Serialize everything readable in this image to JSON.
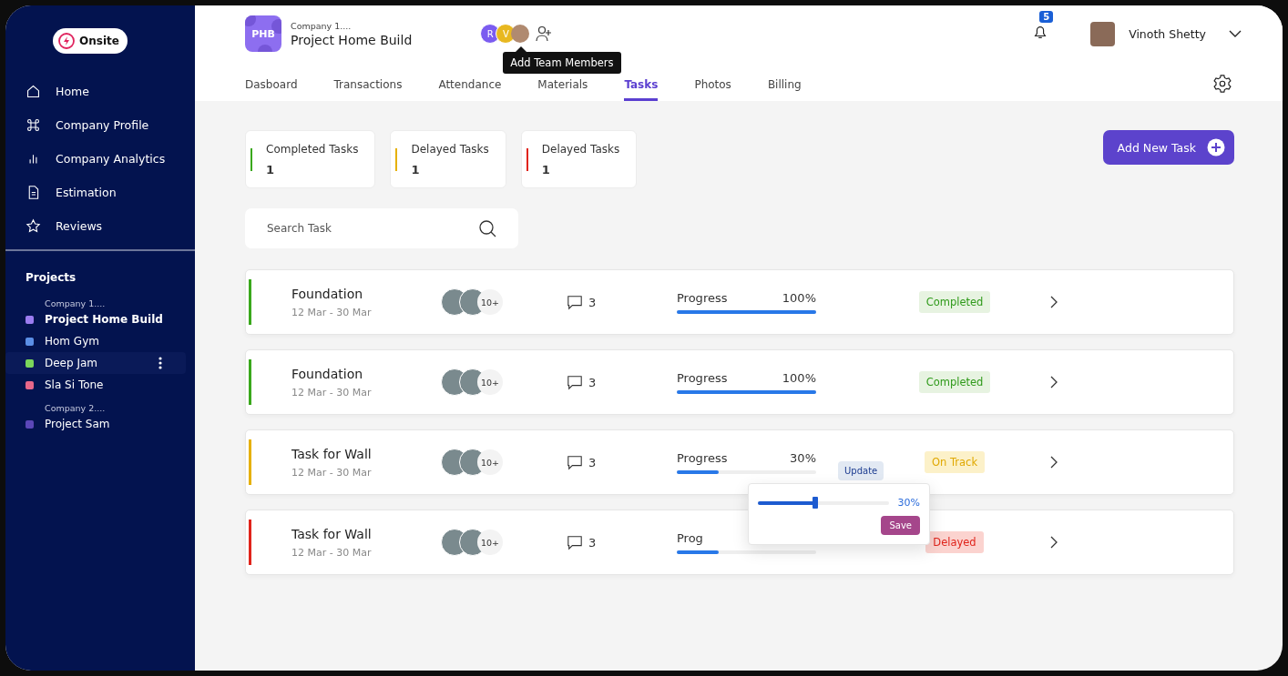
{
  "sidebar": {
    "logo": "Onsite",
    "nav": [
      {
        "label": "Home",
        "kind": "home"
      },
      {
        "label": "Company Profile",
        "kind": "command"
      },
      {
        "label": "Company Analytics",
        "kind": "chart"
      },
      {
        "label": "Estimation",
        "kind": "doc"
      },
      {
        "label": "Reviews",
        "kind": "star"
      }
    ],
    "projects_title": "Projects",
    "groups": [
      {
        "company": "Company 1....",
        "projects": [
          {
            "name": "Project Home Build",
            "color": "#9b7cf0",
            "selected": true,
            "highlighted": false
          },
          {
            "name": "Hom Gym",
            "color": "#5b8fe6",
            "selected": false,
            "highlighted": false
          },
          {
            "name": "Deep Jam",
            "color": "#7bd65b",
            "selected": false,
            "highlighted": true
          },
          {
            "name": "Sla Si Tone",
            "color": "#e8678a",
            "selected": false,
            "highlighted": false
          }
        ]
      },
      {
        "company": "Company 2....",
        "projects": [
          {
            "name": "Project Sam",
            "color": "#5b47b8",
            "selected": false,
            "highlighted": false
          }
        ]
      }
    ]
  },
  "header": {
    "project_initials": "PHB",
    "company": "Company 1....",
    "project": "Project Home Build",
    "team": [
      {
        "initial": "R",
        "color": "#7b5cf0"
      },
      {
        "initial": "V",
        "color": "#e8b820"
      }
    ],
    "tooltip": "Add Team Members",
    "notifications": "5",
    "user": "Vinoth Shetty"
  },
  "tabs": [
    {
      "label": "Dasboard",
      "selected": false
    },
    {
      "label": "Transactions",
      "selected": false
    },
    {
      "label": "Attendance",
      "selected": false
    },
    {
      "label": "Materials",
      "selected": false
    },
    {
      "label": "Tasks",
      "selected": true
    },
    {
      "label": "Photos",
      "selected": false
    },
    {
      "label": "Billing",
      "selected": false
    }
  ],
  "stats": [
    {
      "label": "Completed Tasks",
      "value": "1",
      "color": "#3aa81c"
    },
    {
      "label": "Delayed Tasks",
      "value": "1",
      "color": "#e6b000"
    },
    {
      "label": "Delayed Tasks",
      "value": "1",
      "color": "#e0241b"
    }
  ],
  "add_button": "Add New Task",
  "search": {
    "placeholder": "Search Task"
  },
  "tasks": [
    {
      "title": "Foundation",
      "dates": "12 Mar - 30 Mar",
      "color": "#3aa81c",
      "members": "10+",
      "comments": "3",
      "progress_label": "Progress",
      "percent": "100%",
      "level": 1,
      "status": {
        "label": "Completed",
        "kind": "completed"
      }
    },
    {
      "title": "Foundation",
      "dates": "12 Mar - 30 Mar",
      "color": "#3aa81c",
      "members": "10+",
      "comments": "3",
      "progress_label": "Progress",
      "percent": "100%",
      "level": 1,
      "status": {
        "label": "Completed",
        "kind": "completed"
      }
    },
    {
      "title": "Task for Wall",
      "dates": "12 Mar - 30 Mar",
      "color": "#e6b000",
      "members": "10+",
      "comments": "3",
      "progress_label": "Progress",
      "percent": "30%",
      "level": 0.3,
      "update": "Update",
      "popup": {
        "level": 0.44,
        "reading": "30%",
        "save": "Save"
      },
      "status": {
        "label": "On Track",
        "kind": "on_track"
      }
    },
    {
      "title": "Task for Wall",
      "dates": "12 Mar - 30 Mar",
      "color": "#e0241b",
      "members": "10+",
      "comments": "3",
      "progress_label": "Prog",
      "level": 0.3,
      "status": {
        "label": "Delayed",
        "kind": "delayed"
      }
    }
  ]
}
